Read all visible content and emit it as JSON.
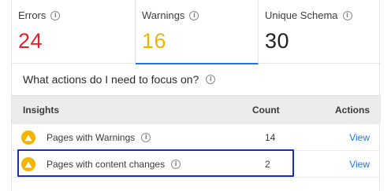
{
  "metrics": {
    "errors": {
      "label": "Errors",
      "value": "24"
    },
    "warnings": {
      "label": "Warnings",
      "value": "16"
    },
    "unique": {
      "label": "Unique Schema",
      "value": "30"
    }
  },
  "actions": {
    "title": "What actions do I need to focus on?"
  },
  "table": {
    "headers": {
      "insights": "Insights",
      "count": "Count",
      "actions": "Actions"
    },
    "rows": [
      {
        "name": "Pages with Warnings",
        "count": "14",
        "action": "View"
      },
      {
        "name": "Pages with content changes",
        "count": "2",
        "action": "View"
      }
    ]
  },
  "colors": {
    "errors": "#e02330",
    "warnings": "#f0b400",
    "accent": "#1a73e8",
    "highlight_border": "#1c2bbf"
  },
  "icons": {
    "info": "info-icon",
    "warning": "warning-triangle-icon"
  }
}
